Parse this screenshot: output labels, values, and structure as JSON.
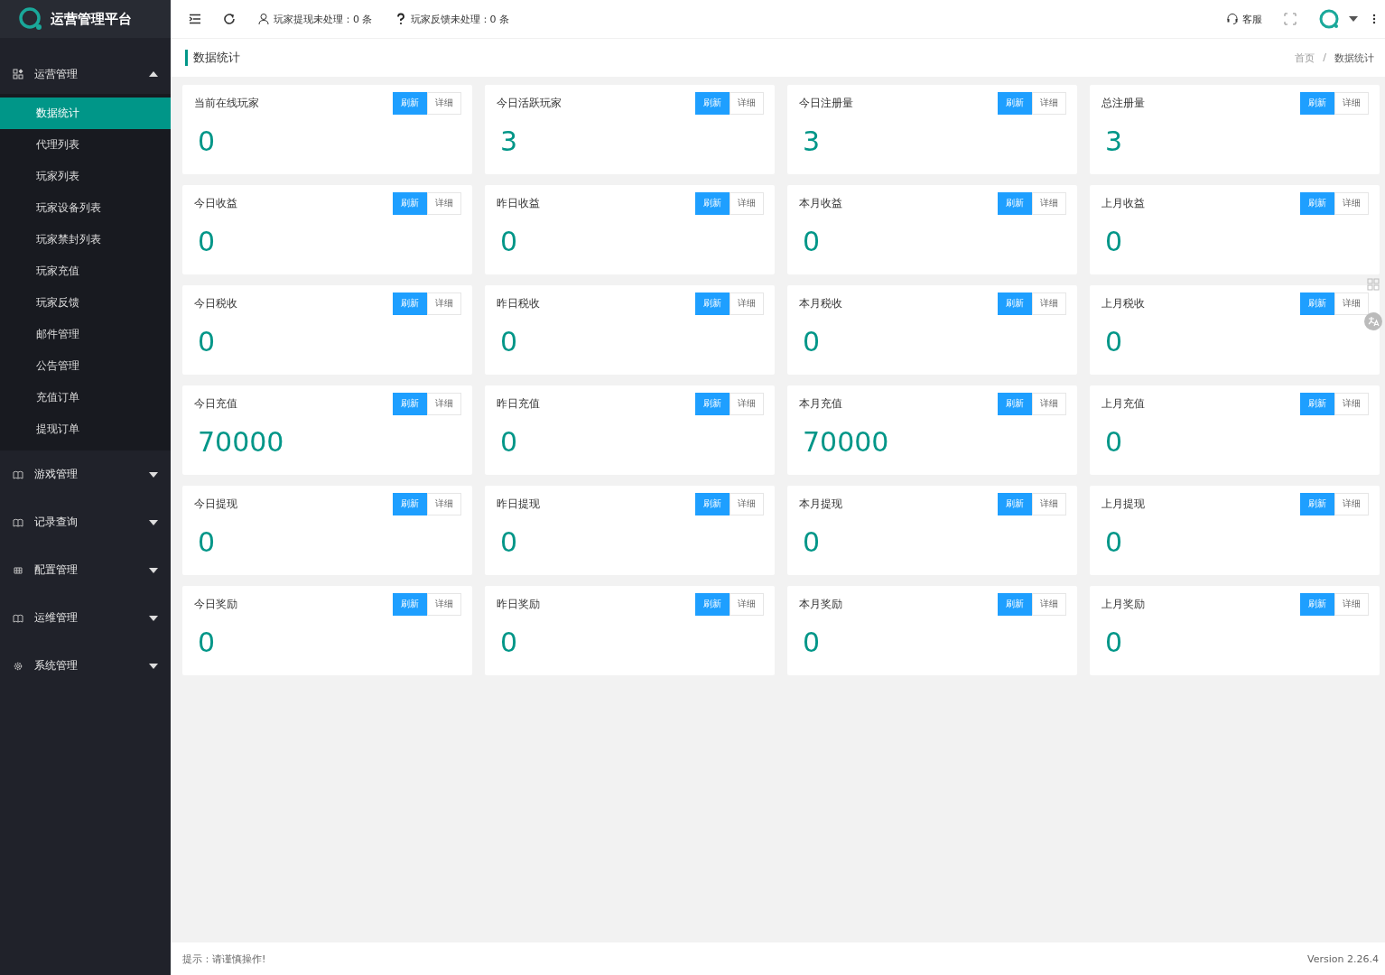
{
  "sidebar": {
    "logo_text": "运营管理平台",
    "groups": [
      {
        "label": "运营管理",
        "kind": "grid",
        "expanded": true,
        "children": [
          {
            "label": "数据统计",
            "selected": true
          },
          {
            "label": "代理列表",
            "selected": false
          },
          {
            "label": "玩家列表",
            "selected": false
          },
          {
            "label": "玩家设备列表",
            "selected": false
          },
          {
            "label": "玩家禁封列表",
            "selected": false
          },
          {
            "label": "玩家充值",
            "selected": false
          },
          {
            "label": "玩家反馈",
            "selected": false
          },
          {
            "label": "邮件管理",
            "selected": false
          },
          {
            "label": "公告管理",
            "selected": false
          },
          {
            "label": "充值订单",
            "selected": false
          },
          {
            "label": "提现订单",
            "selected": false
          }
        ]
      },
      {
        "label": "游戏管理",
        "kind": "book",
        "expanded": false
      },
      {
        "label": "记录查询",
        "kind": "book",
        "expanded": false
      },
      {
        "label": "配置管理",
        "kind": "table",
        "expanded": false
      },
      {
        "label": "运维管理",
        "kind": "book",
        "expanded": false
      },
      {
        "label": "系统管理",
        "kind": "gear",
        "expanded": false
      }
    ]
  },
  "header": {
    "notices": [
      {
        "kind": "user",
        "text": "玩家提现未处理：0 条"
      },
      {
        "kind": "question",
        "text": "玩家反馈未处理：0 条"
      }
    ],
    "service": "客服"
  },
  "page_title": "数据统计",
  "breadcrumb": {
    "items": [
      "首页",
      "数据统计"
    ],
    "separator": "/"
  },
  "cards": [
    {
      "title": "当前在线玩家",
      "value": "0",
      "refresh": "刷新",
      "detail": "详细"
    },
    {
      "title": "今日活跃玩家",
      "value": "3",
      "refresh": "刷新",
      "detail": "详细"
    },
    {
      "title": "今日注册量",
      "value": "3",
      "refresh": "刷新",
      "detail": "详细"
    },
    {
      "title": "总注册量",
      "value": "3",
      "refresh": "刷新",
      "detail": "详细"
    },
    {
      "title": "今日收益",
      "value": "0",
      "refresh": "刷新",
      "detail": "详细"
    },
    {
      "title": "昨日收益",
      "value": "0",
      "refresh": "刷新",
      "detail": "详细"
    },
    {
      "title": "本月收益",
      "value": "0",
      "refresh": "刷新",
      "detail": "详细"
    },
    {
      "title": "上月收益",
      "value": "0",
      "refresh": "刷新",
      "detail": "详细"
    },
    {
      "title": "今日税收",
      "value": "0",
      "refresh": "刷新",
      "detail": "详细"
    },
    {
      "title": "昨日税收",
      "value": "0",
      "refresh": "刷新",
      "detail": "详细"
    },
    {
      "title": "本月税收",
      "value": "0",
      "refresh": "刷新",
      "detail": "详细"
    },
    {
      "title": "上月税收",
      "value": "0",
      "refresh": "刷新",
      "detail": "详细"
    },
    {
      "title": "今日充值",
      "value": "70000",
      "refresh": "刷新",
      "detail": "详细"
    },
    {
      "title": "昨日充值",
      "value": "0",
      "refresh": "刷新",
      "detail": "详细"
    },
    {
      "title": "本月充值",
      "value": "70000",
      "refresh": "刷新",
      "detail": "详细"
    },
    {
      "title": "上月充值",
      "value": "0",
      "refresh": "刷新",
      "detail": "详细"
    },
    {
      "title": "今日提现",
      "value": "0",
      "refresh": "刷新",
      "detail": "详细"
    },
    {
      "title": "昨日提现",
      "value": "0",
      "refresh": "刷新",
      "detail": "详细"
    },
    {
      "title": "本月提现",
      "value": "0",
      "refresh": "刷新",
      "detail": "详细"
    },
    {
      "title": "上月提现",
      "value": "0",
      "refresh": "刷新",
      "detail": "详细"
    },
    {
      "title": "今日奖励",
      "value": "0",
      "refresh": "刷新",
      "detail": "详细"
    },
    {
      "title": "昨日奖励",
      "value": "0",
      "refresh": "刷新",
      "detail": "详细"
    },
    {
      "title": "本月奖励",
      "value": "0",
      "refresh": "刷新",
      "detail": "详细"
    },
    {
      "title": "上月奖励",
      "value": "0",
      "refresh": "刷新",
      "detail": "详细"
    }
  ],
  "footer": {
    "tip": "提示：请谨慎操作!",
    "version": "Version 2.26.4"
  }
}
